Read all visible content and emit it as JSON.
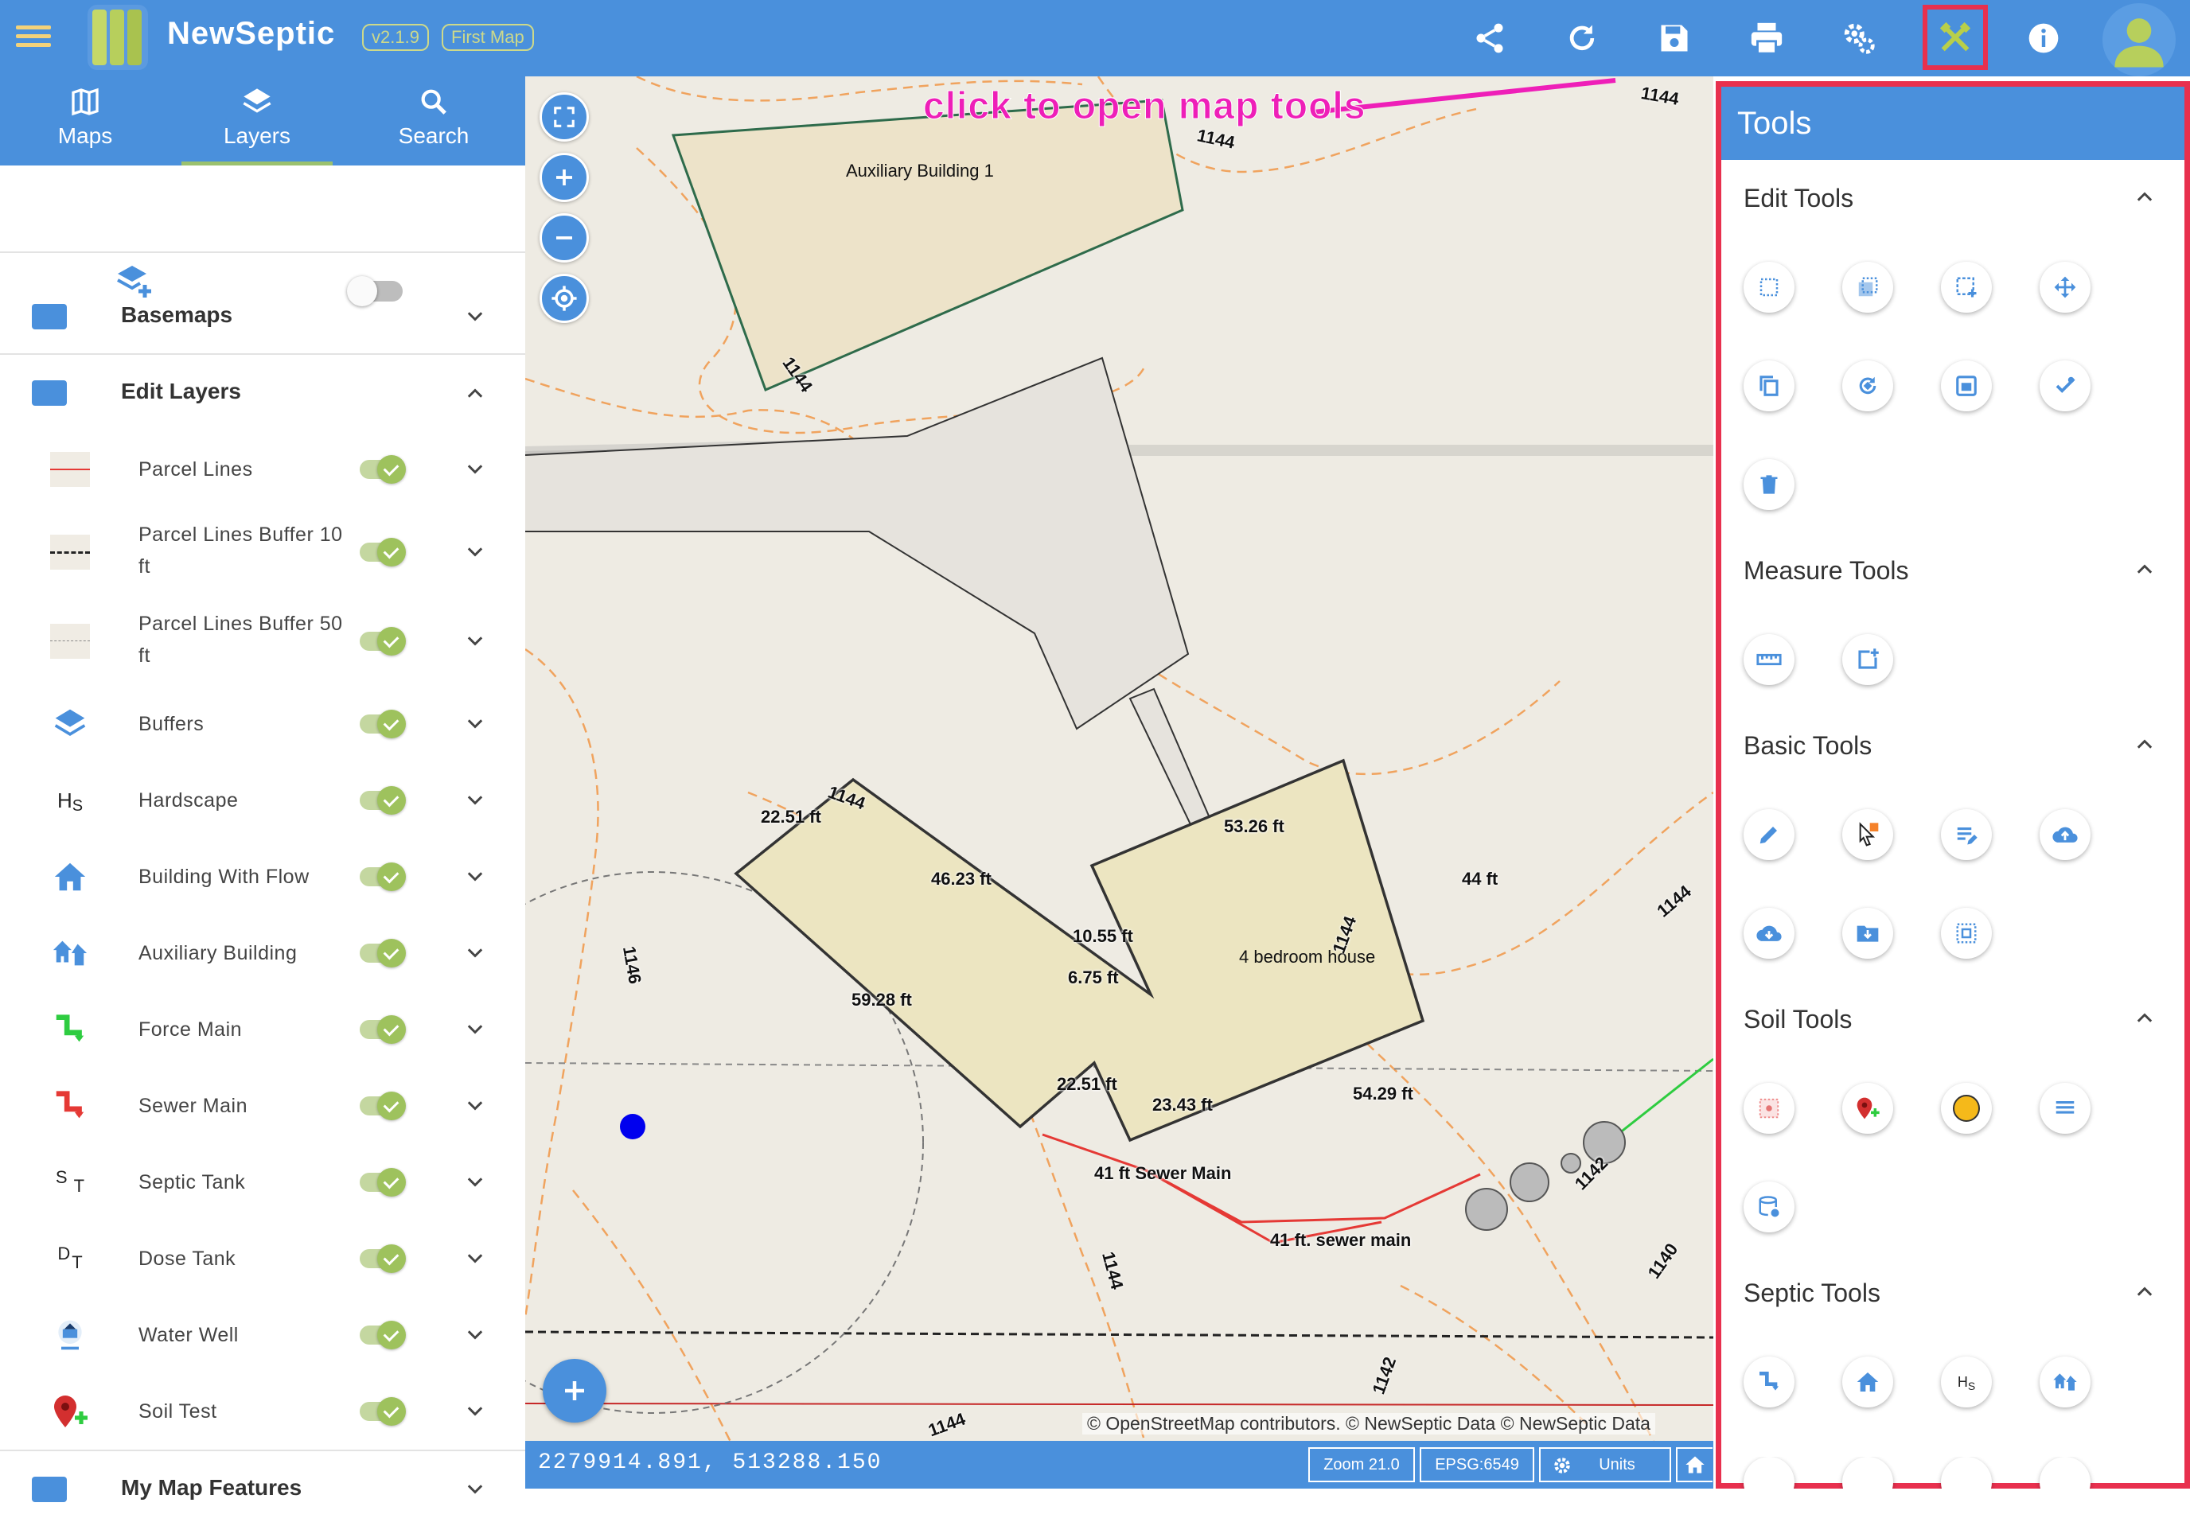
{
  "app": {
    "name": "NewSeptic",
    "version": "v2.1.9",
    "map_name": "First Map",
    "colors": {
      "primary": "#4a90dc",
      "highlight": "#e8304e",
      "annotation": "#ee1fb8",
      "toggle_on": "#9ec25d"
    }
  },
  "header_icons": [
    "share-icon",
    "refresh-icon",
    "save-icon",
    "print-icon",
    "settings-icon",
    "tools-icon",
    "info-icon",
    "user-avatar-icon"
  ],
  "sidebar": {
    "tabs": [
      {
        "label": "Maps",
        "icon": "map-icon"
      },
      {
        "label": "Layers",
        "icon": "layers-icon",
        "active": true
      },
      {
        "label": "Search",
        "icon": "search-icon"
      }
    ],
    "sections": {
      "basemaps": "Basemaps",
      "edit_layers": "Edit Layers",
      "my_map_features": "My Map Features"
    },
    "layers": [
      {
        "label": "Parcel Lines",
        "icon": "red-line-icon",
        "visible": true
      },
      {
        "label": "Parcel Lines Buffer 10 ft",
        "icon": "dashed-line-icon",
        "visible": true
      },
      {
        "label": "Parcel Lines Buffer 50 ft",
        "icon": "dotted-line-icon",
        "visible": true
      },
      {
        "label": "Buffers",
        "icon": "layers-icon",
        "visible": true
      },
      {
        "label": "Hardscape",
        "icon": "hardscape-icon",
        "visible": true
      },
      {
        "label": "Building With Flow",
        "icon": "house-icon",
        "visible": true
      },
      {
        "label": "Auxiliary Building",
        "icon": "auxiliary-building-icon",
        "visible": true
      },
      {
        "label": "Force Main",
        "icon": "force-main-icon",
        "visible": true
      },
      {
        "label": "Sewer Main",
        "icon": "sewer-main-icon",
        "visible": true
      },
      {
        "label": "Septic Tank",
        "icon": "septic-tank-icon",
        "visible": true
      },
      {
        "label": "Dose Tank",
        "icon": "dose-tank-icon",
        "visible": true
      },
      {
        "label": "Water Well",
        "icon": "water-well-icon",
        "visible": true
      },
      {
        "label": "Soil Test",
        "icon": "soil-test-icon",
        "visible": true
      }
    ],
    "icon_text": {
      "hs1": "H",
      "hs2": "S",
      "st1": "S",
      "st2": "T",
      "dt1": "D",
      "dt2": "T"
    }
  },
  "map": {
    "annotation": "click to open map tools",
    "labels": {
      "aux_building": "Auxiliary Building 1",
      "house": "4 bedroom house",
      "sewer_main_1": "41 ft Sewer Main",
      "sewer_main_2": "41 ft. sewer main"
    },
    "measurements": [
      "22.51 ft",
      "46.23 ft",
      "59.28 ft",
      "10.55 ft",
      "6.75 ft",
      "53.26 ft",
      "44 ft",
      "22.51 ft",
      "23.43 ft",
      "54.29 ft"
    ],
    "contours": [
      "1144",
      "1144",
      "1144",
      "1144",
      "1146",
      "1144",
      "1142",
      "1144",
      "1140",
      "1142",
      "1144",
      "1144"
    ],
    "attribution": "© OpenStreetMap contributors. © NewSeptic Data © NewSeptic Data",
    "coordinates": "2279914.891, 513288.150",
    "zoom": "Zoom 21.0",
    "epsg": "EPSG:6549",
    "units": "Units"
  },
  "tools_panel": {
    "title": "Tools",
    "groups": [
      {
        "label": "Edit Tools",
        "tools": [
          "select-box-icon",
          "select-multiple-icon",
          "select-add-icon",
          "move-icon",
          "copy-icon",
          "rotate-icon",
          "scale-icon",
          "edit-vertex-icon",
          "delete-icon"
        ]
      },
      {
        "label": "Measure Tools",
        "tools": [
          "ruler-icon",
          "area-measure-icon"
        ]
      },
      {
        "label": "Basic Tools",
        "tools": [
          "pencil-icon",
          "pointer-add-icon",
          "edit-text-icon",
          "cloud-upload-icon",
          "cloud-download-icon",
          "folder-download-icon",
          "select-center-icon"
        ]
      },
      {
        "label": "Soil Tools",
        "tools": [
          "soil-map-icon",
          "soil-pin-icon",
          "soil-point-icon",
          "soil-list-icon",
          "soil-database-icon"
        ]
      },
      {
        "label": "Septic Tools",
        "tools": [
          "force-main-tool-icon",
          "house-tool-icon",
          "hardscape-tool-icon",
          "auxiliary-tool-icon"
        ]
      }
    ]
  }
}
